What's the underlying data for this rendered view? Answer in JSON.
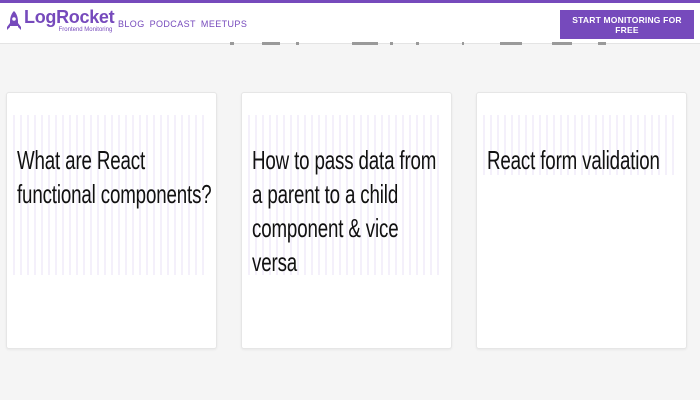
{
  "header": {
    "logo": {
      "name": "LogRocket",
      "tagline": "Frontend Monitoring",
      "icon": "rocket-icon"
    },
    "nav": [
      {
        "label": "BLOG"
      },
      {
        "label": "PODCAST"
      },
      {
        "label": "MEETUPS"
      }
    ],
    "cta_label": "START MONITORING FOR FREE"
  },
  "cards": [
    {
      "title": "What are React functional components?"
    },
    {
      "title": "How to pass data from a parent to a child component & vice versa"
    },
    {
      "title": "React form validation"
    }
  ],
  "colors": {
    "brand": "#764abc",
    "page_bg": "#f5f5f5",
    "card_bg": "#ffffff",
    "text": "#111111"
  }
}
